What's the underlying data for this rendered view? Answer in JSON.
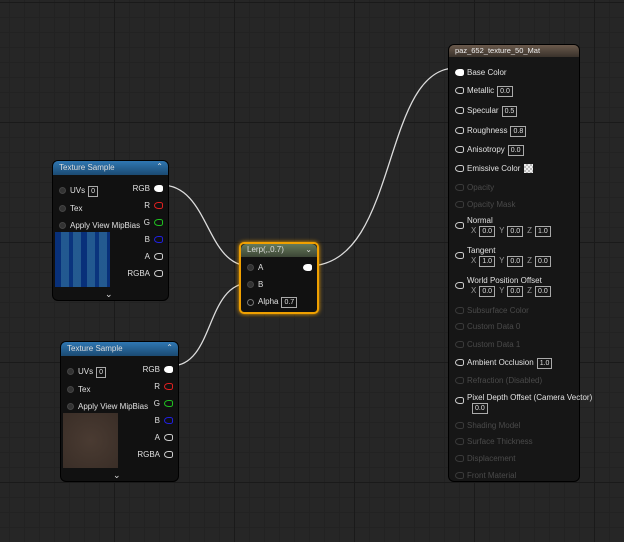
{
  "texture_sample_1": {
    "title": "Texture Sample",
    "inputs": {
      "uvs": "UVs",
      "uvs_value": "0",
      "tex": "Tex",
      "mip": "Apply View MipBias"
    },
    "outputs": [
      "RGB",
      "R",
      "G",
      "B",
      "A",
      "RGBA"
    ]
  },
  "texture_sample_2": {
    "title": "Texture Sample",
    "inputs": {
      "uvs": "UVs",
      "uvs_value": "0",
      "tex": "Tex",
      "mip": "Apply View MipBias"
    },
    "outputs": [
      "RGB",
      "R",
      "G",
      "B",
      "A",
      "RGBA"
    ]
  },
  "lerp": {
    "title": "Lerp(,,0.7)",
    "a": "A",
    "b": "B",
    "alpha": "Alpha",
    "alpha_value": "0.7"
  },
  "material": {
    "title": "paz_652_texture_50_Mat",
    "rows": [
      {
        "label": "Base Color",
        "state": "connected"
      },
      {
        "label": "Metallic",
        "value": "0.0"
      },
      {
        "label": "Specular",
        "value": "0.5"
      },
      {
        "label": "Roughness",
        "value": "0.8"
      },
      {
        "label": "Anisotropy",
        "value": "0.0"
      },
      {
        "label": "Emissive Color",
        "swatch": true
      },
      {
        "label": "Opacity",
        "state": "disabled"
      },
      {
        "label": "Opacity Mask",
        "state": "disabled"
      },
      {
        "label": "Normal",
        "xyz": [
          "0.0",
          "0.0",
          "1.0"
        ]
      },
      {
        "label": "Tangent",
        "xyz": [
          "1.0",
          "0.0",
          "0.0"
        ]
      },
      {
        "label": "World Position Offset",
        "xyz": [
          "0.0",
          "0.0",
          "0.0"
        ]
      },
      {
        "label": "Subsurface Color",
        "state": "disabled"
      },
      {
        "label": "Custom Data 0",
        "state": "disabled"
      },
      {
        "label": "Custom Data 1",
        "state": "disabled"
      },
      {
        "label": "Ambient Occlusion",
        "value": "1.0"
      },
      {
        "label": "Refraction (Disabled)",
        "state": "disabled"
      },
      {
        "label": "Pixel Depth Offset (Camera Vector)",
        "value": "0.0",
        "below": true
      },
      {
        "label": "Shading Model",
        "state": "disabled"
      },
      {
        "label": "Surface Thickness",
        "state": "disabled"
      },
      {
        "label": "Displacement",
        "state": "disabled"
      },
      {
        "label": "Front Material",
        "state": "disabled"
      }
    ]
  },
  "axis_labels": [
    "X",
    "Y",
    "Z"
  ],
  "colors": {
    "r": "#e02020",
    "g": "#20c020",
    "b": "#2020e0",
    "select": "#f0a000"
  }
}
